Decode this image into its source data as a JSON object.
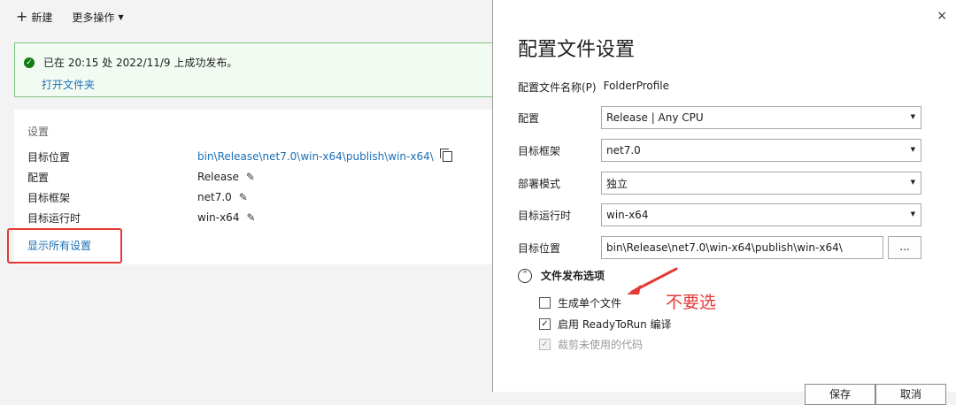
{
  "toolbar": {
    "new_label": "新建",
    "more_label": "更多操作"
  },
  "success": {
    "message": "已在 20:15 处 2022/11/9 上成功发布。",
    "open_folder": "打开文件夹"
  },
  "settings": {
    "title": "设置",
    "rows": [
      {
        "key": "目标位置",
        "value": "bin\\Release\\net7.0\\win-x64\\publish\\win-x64\\"
      },
      {
        "key": "配置",
        "value": "Release"
      },
      {
        "key": "目标框架",
        "value": "net7.0"
      },
      {
        "key": "目标运行时",
        "value": "win-x64"
      }
    ],
    "show_all": "显示所有设置"
  },
  "dialog": {
    "title": "配置文件设置",
    "close": "×",
    "profile_name_label": "配置文件名称(P)",
    "profile_name_value": "FolderProfile",
    "fields": [
      {
        "label": "配置",
        "value": "Release | Any CPU"
      },
      {
        "label": "目标框架",
        "value": "net7.0"
      },
      {
        "label": "部署模式",
        "value": "独立"
      },
      {
        "label": "目标运行时",
        "value": "win-x64"
      }
    ],
    "target_location_label": "目标位置",
    "target_location_value": "bin\\Release\\net7.0\\win-x64\\publish\\win-x64\\",
    "browse_label": "...",
    "section_title": "文件发布选项",
    "options": [
      {
        "label": "生成单个文件",
        "checked": false,
        "enabled": true
      },
      {
        "label": "启用 ReadyToRun 编译",
        "checked": true,
        "enabled": true
      },
      {
        "label": "裁剪未使用的代码",
        "checked": true,
        "enabled": false
      }
    ],
    "save_label": "保存",
    "cancel_label": "取消"
  },
  "annotation": {
    "text": "不要选",
    "color": "#e53935"
  },
  "colors": {
    "link": "#1a6fb5",
    "success_border": "#7fc47f",
    "success_icon": "#107c10"
  }
}
